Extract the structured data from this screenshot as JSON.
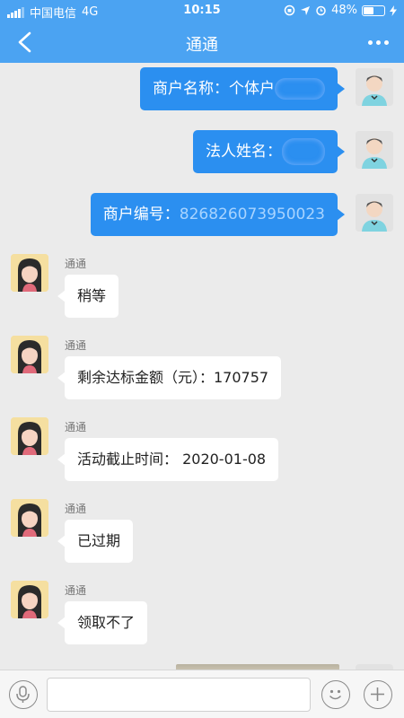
{
  "status_bar": {
    "carrier": "中国电信",
    "network": "4G",
    "time": "10:15",
    "battery": "48%",
    "battery_level": 0.48
  },
  "nav": {
    "title": "通通",
    "back_icon": "chevron-left-icon",
    "more_icon": "more-icon"
  },
  "outgoing_messages": [
    {
      "label": "商户名称：",
      "value": "个体户"
    },
    {
      "label": "法人姓名：",
      "value": ""
    },
    {
      "label": "商户编号：",
      "value": "826826073950023"
    }
  ],
  "incoming_messages": [
    {
      "sender": "通通",
      "text": "稍等"
    },
    {
      "sender": "通通",
      "text": "剩余达标金额（元）：170757"
    },
    {
      "sender": "通通",
      "text": "活动截止时间： 2020-01-08"
    },
    {
      "sender": "通通",
      "text": "已过期"
    },
    {
      "sender": "通通",
      "text": "领取不了"
    }
  ],
  "input_bar": {
    "input_value": "",
    "icons": [
      "microphone-icon",
      "emoji-icon",
      "plus-icon"
    ]
  },
  "colors": {
    "header": "#4ba3f2",
    "outgoing_bubble": "#2b8ff0",
    "incoming_bubble": "#ffffff",
    "chat_background": "#ebebeb",
    "account_number": "#a8d4ff"
  }
}
